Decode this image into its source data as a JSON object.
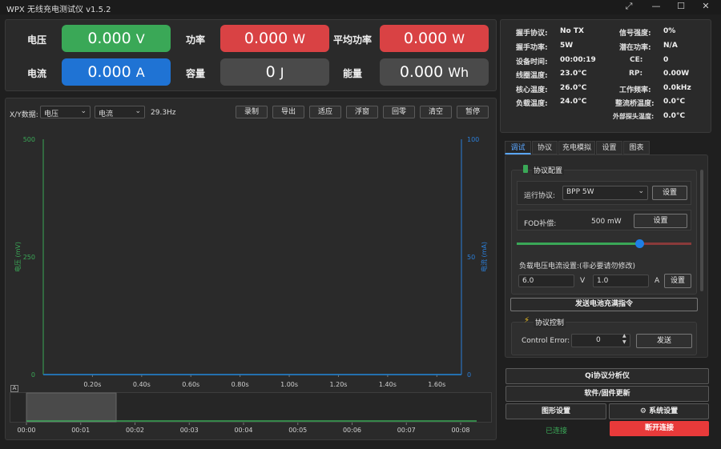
{
  "window": {
    "title": "WPX 无线充电测试仪 v1.5.2"
  },
  "metrics": [
    {
      "label": "电压",
      "value": "0.000",
      "unit": "V",
      "color": "#3aa857"
    },
    {
      "label": "功率",
      "value": "0.000",
      "unit": "W",
      "color": "#d94244"
    },
    {
      "label": "平均功率",
      "value": "0.000",
      "unit": "W",
      "color": "#d94244"
    },
    {
      "label": "电流",
      "value": "0.000",
      "unit": "A",
      "color": "#1f73d4"
    },
    {
      "label": "容量",
      "value": "0",
      "unit": "J",
      "color": "#4a4a4a"
    },
    {
      "label": "能量",
      "value": "0.000",
      "unit": "Wh",
      "color": "#4a4a4a"
    }
  ],
  "toolbar": {
    "xy_label": "X/Y数据:",
    "x_select": "电压",
    "y_select": "电流",
    "rate": "29.3Hz",
    "buttons": [
      "录制",
      "导出",
      "适应",
      "浮窗",
      "回零",
      "清空",
      "暂停"
    ]
  },
  "chart": {
    "y_left_label": "电压 (mV)",
    "y_right_label": "电流 (mA)",
    "y_left_ticks": [
      "500",
      "250",
      "0"
    ],
    "y_right_ticks": [
      "100",
      "50",
      "0"
    ],
    "x_ticks": [
      "0.20s",
      "0.40s",
      "0.60s",
      "0.80s",
      "1.00s",
      "1.20s",
      "1.40s",
      "1.60s"
    ],
    "overview_ticks": [
      "00:00",
      "00:01",
      "00:02",
      "00:03",
      "00:04",
      "00:05",
      "00:06",
      "00:07",
      "00:08"
    ],
    "collapse_label": "A"
  },
  "chart_data": {
    "type": "line",
    "xlabel": "",
    "ylabel": "电压 (mV)",
    "y2label": "电流 (mA)",
    "xlim": [
      0,
      1.7
    ],
    "ylim": [
      0,
      500
    ],
    "y2lim": [
      0,
      100
    ],
    "grid": false,
    "series": [
      {
        "x": [
          0,
          1.7
        ],
        "values": [
          0,
          0
        ],
        "color": "#3aa857"
      },
      {
        "x": [
          0,
          1.7
        ],
        "values": [
          0,
          0
        ],
        "color": "#1f73d4"
      }
    ]
  },
  "info_left": [
    {
      "label": "握手协议:",
      "value": "No TX"
    },
    {
      "label": "握手功率:",
      "value": "5W"
    },
    {
      "label": "设备时间:",
      "value": "00:00:19"
    },
    {
      "label": "线圈温度:",
      "value": "23.0°C"
    },
    {
      "label": "核心温度:",
      "value": "26.0°C"
    },
    {
      "label": "负载温度:",
      "value": "24.0°C"
    }
  ],
  "info_right": [
    {
      "label": "信号强度:",
      "value": "0%"
    },
    {
      "label": "潜在功率:",
      "value": "N/A"
    },
    {
      "label": "CE:",
      "value": "0"
    },
    {
      "label": "RP:",
      "value": "0.00W"
    },
    {
      "label": "工作频率:",
      "value": "0.0kHz"
    },
    {
      "label": "整流桥温度:",
      "value": "0.0°C"
    },
    {
      "label": "外部探头温度:",
      "value": "0.0°C"
    }
  ],
  "tabs": [
    "调试",
    "协议",
    "充电模拟",
    "设置",
    "图表"
  ],
  "protocol_config": {
    "title": "协议配置",
    "run_label": "运行协议:",
    "run_value": "BPP 5W",
    "set_label": "设置",
    "fod_label": "FOD补偿:",
    "fod_value": "500 mW",
    "slider_level": 0.7,
    "load_label": "负载电压电流设置:(非必要请勿修改)",
    "voltage_value": "6.0",
    "voltage_unit": "V",
    "current_value": "1.0",
    "current_unit": "A"
  },
  "full_charge_button": "发送电池充满指令",
  "protocol_control": {
    "title": "协议控制",
    "ce_label": "Control Error:",
    "ce_value": "0",
    "send_label": "发送"
  },
  "bottom_buttons": {
    "qi_analyzer": "Qi协议分析仪",
    "firmware": "软件/固件更新",
    "graphics": "图形设置",
    "system": "系统设置",
    "connected": "已连接",
    "disconnect": "断开连接"
  }
}
